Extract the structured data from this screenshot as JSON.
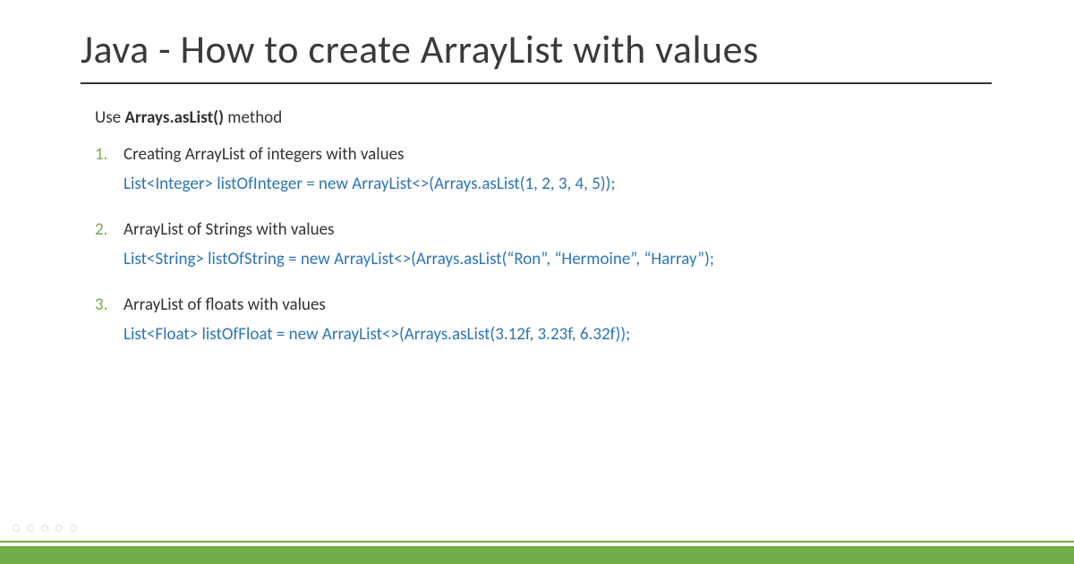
{
  "title": "Java - How to create ArrayList with values",
  "intro_prefix": "Use ",
  "intro_bold": "Arrays.asList()",
  "intro_suffix": " method",
  "accent_color": "#70AD47",
  "code_color": "#2E75B6",
  "items": [
    {
      "num": "1.",
      "label": "Creating ArrayList of integers with values",
      "code": "List<Integer> listOfInteger = new ArrayList<>(Arrays.asList(1, 2, 3, 4, 5));"
    },
    {
      "num": "2.",
      "label": "ArrayList of Strings with values",
      "code": "List<String> listOfString = new ArrayList<>(Arrays.asList(“Ron”, “Hermoine”, “Harray”);"
    },
    {
      "num": "3.",
      "label": "ArrayList of floats with values",
      "code": "List<Float> listOfFloat = new ArrayList<>(Arrays.asList(3.12f, 3.23f, 6.32f));"
    }
  ]
}
